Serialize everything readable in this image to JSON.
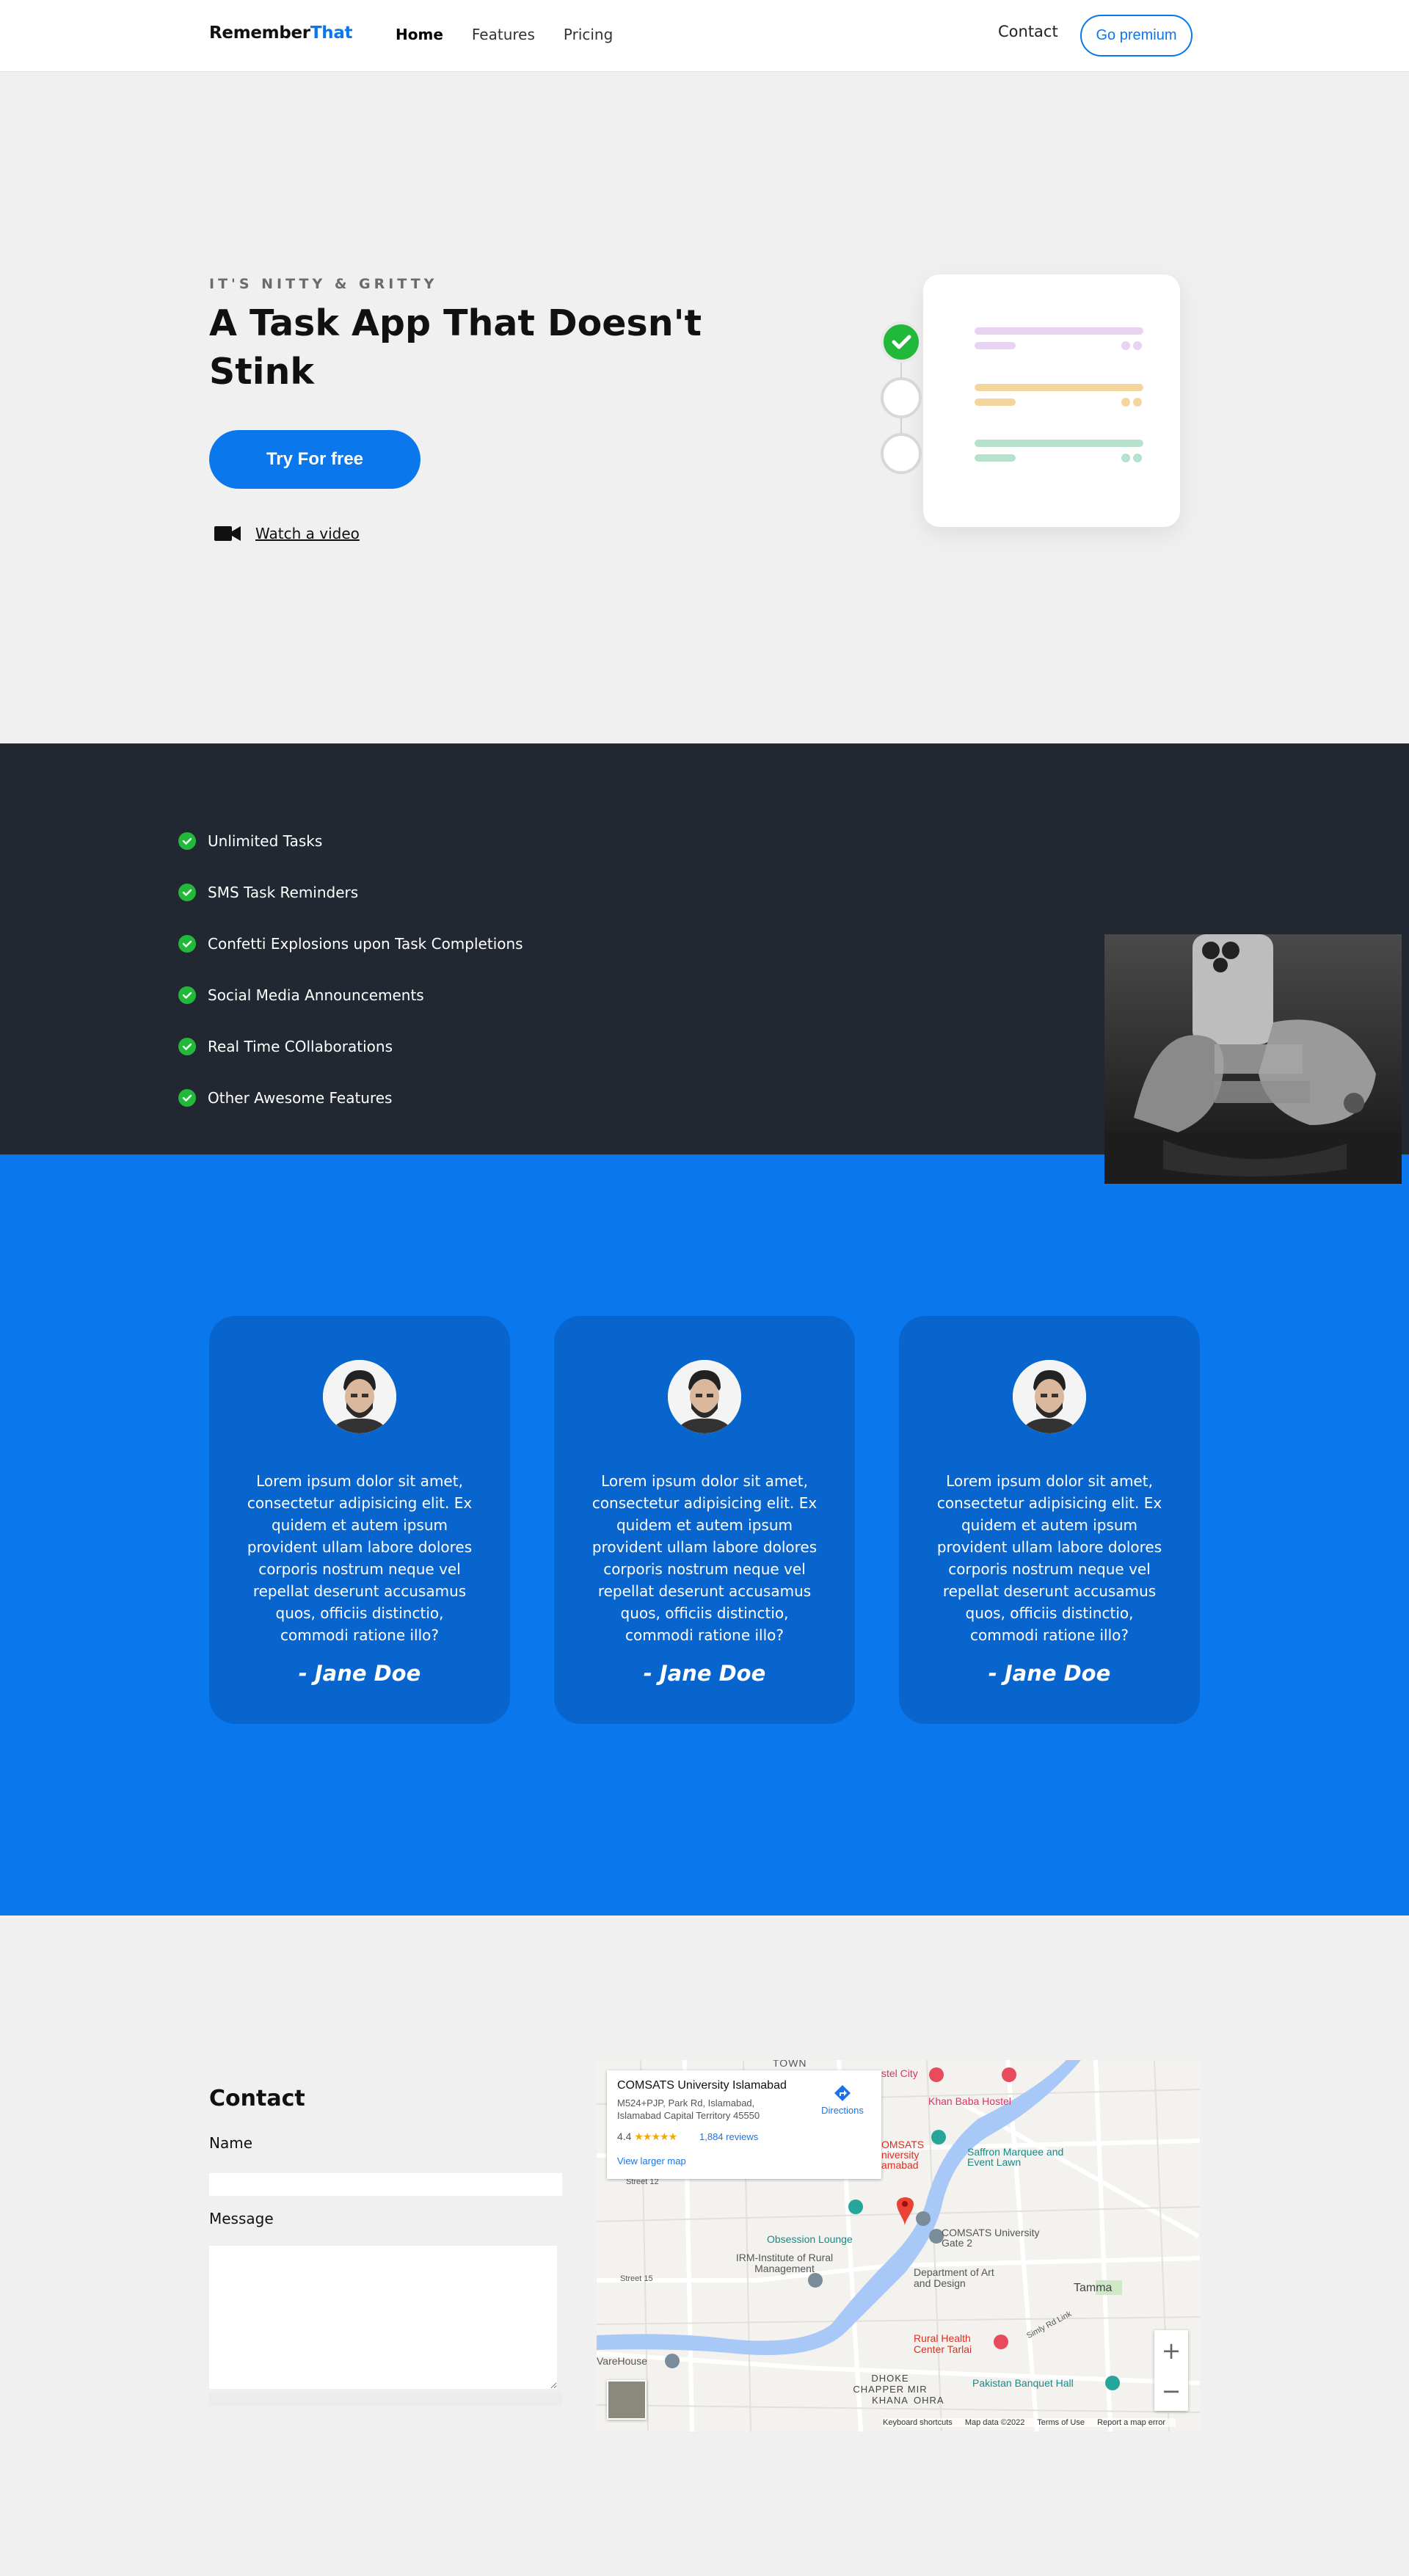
{
  "nav": {
    "brand_part1": "Remember",
    "brand_part2": "That",
    "links": [
      "Home",
      "Features",
      "Pricing"
    ],
    "contact": "Contact",
    "premium": "Go premium"
  },
  "hero": {
    "eyebrow": "IT'S NITTY & GRITTY",
    "title": "A Task App That Doesn't Stink",
    "cta": "Try For free",
    "video_link": "Watch a video",
    "video_icon": "video-camera-icon"
  },
  "features": {
    "items": [
      "Unlimited Tasks",
      "SMS Task Reminders",
      "Confetti Explosions upon Task Completions",
      "Social Media Announcements",
      "Real Time COllaborations",
      "Other Awesome Features"
    ]
  },
  "testimonials": [
    {
      "quote": "Lorem ipsum dolor sit amet, consectetur adipisicing elit. Ex quidem et autem ipsum provident ullam labore dolores corporis nostrum neque vel repellat deserunt accusamus quos, officiis distinctio, commodi ratione illo?",
      "author": "- Jane Doe"
    },
    {
      "quote": "Lorem ipsum dolor sit amet, consectetur adipisicing elit. Ex quidem et autem ipsum provident ullam labore dolores corporis nostrum neque vel repellat deserunt accusamus quos, officiis distinctio, commodi ratione illo?",
      "author": "- Jane Doe"
    },
    {
      "quote": "Lorem ipsum dolor sit amet, consectetur adipisicing elit. Ex quidem et autem ipsum provident ullam labore dolores corporis nostrum neque vel repellat deserunt accusamus quos, officiis distinctio, commodi ratione illo?",
      "author": "- Jane Doe"
    }
  ],
  "contact": {
    "title": "Contact",
    "name_label": "Name",
    "message_label": "Message"
  },
  "map": {
    "place_name": "COMSATS University Islamabad",
    "address": "M524+PJP, Park Rd, Islamabad, Islamabad Capital Territory 45550",
    "rating": "4.4",
    "stars": "★★★★★",
    "reviews": "1,884 reviews",
    "larger_map": "View larger map",
    "directions": "Directions",
    "labels": {
      "town": "TOWN",
      "hostel_city": "stel City",
      "khan_baba": "Khan Baba Hostel",
      "comsats_u": "OMSATS niversity amabad",
      "saffron": "Saffron Marquee and Event Lawn",
      "obsession": "Obsession Lounge",
      "irm": "IRM-Institute of Rural Management",
      "comsats_gate": "COMSATS University Gate 2",
      "dept": "Department of Art and Design",
      "tamma": "Tamma",
      "simly": "Simly Rd Link",
      "rural_health": "Rural Health Center Tarlai",
      "dhoke": "DHOKE CHAPPER MIR KHANA",
      "dhoke2": "OHRA",
      "pakistan_banquet": "Pakistan Banquet Hall",
      "warehouse": "VareHouse",
      "street12": "Street 12",
      "street15": "Street 15"
    },
    "zoom_in": "+",
    "zoom_out": "−",
    "footer": [
      "Keyboard shortcuts",
      "Map data ©2022",
      "Terms of Use",
      "Report a map error"
    ]
  },
  "colors": {
    "accent": "#0a77ec",
    "dark_band": "#222831",
    "card_blue": "#0865cd",
    "check_green": "#22b83a"
  }
}
